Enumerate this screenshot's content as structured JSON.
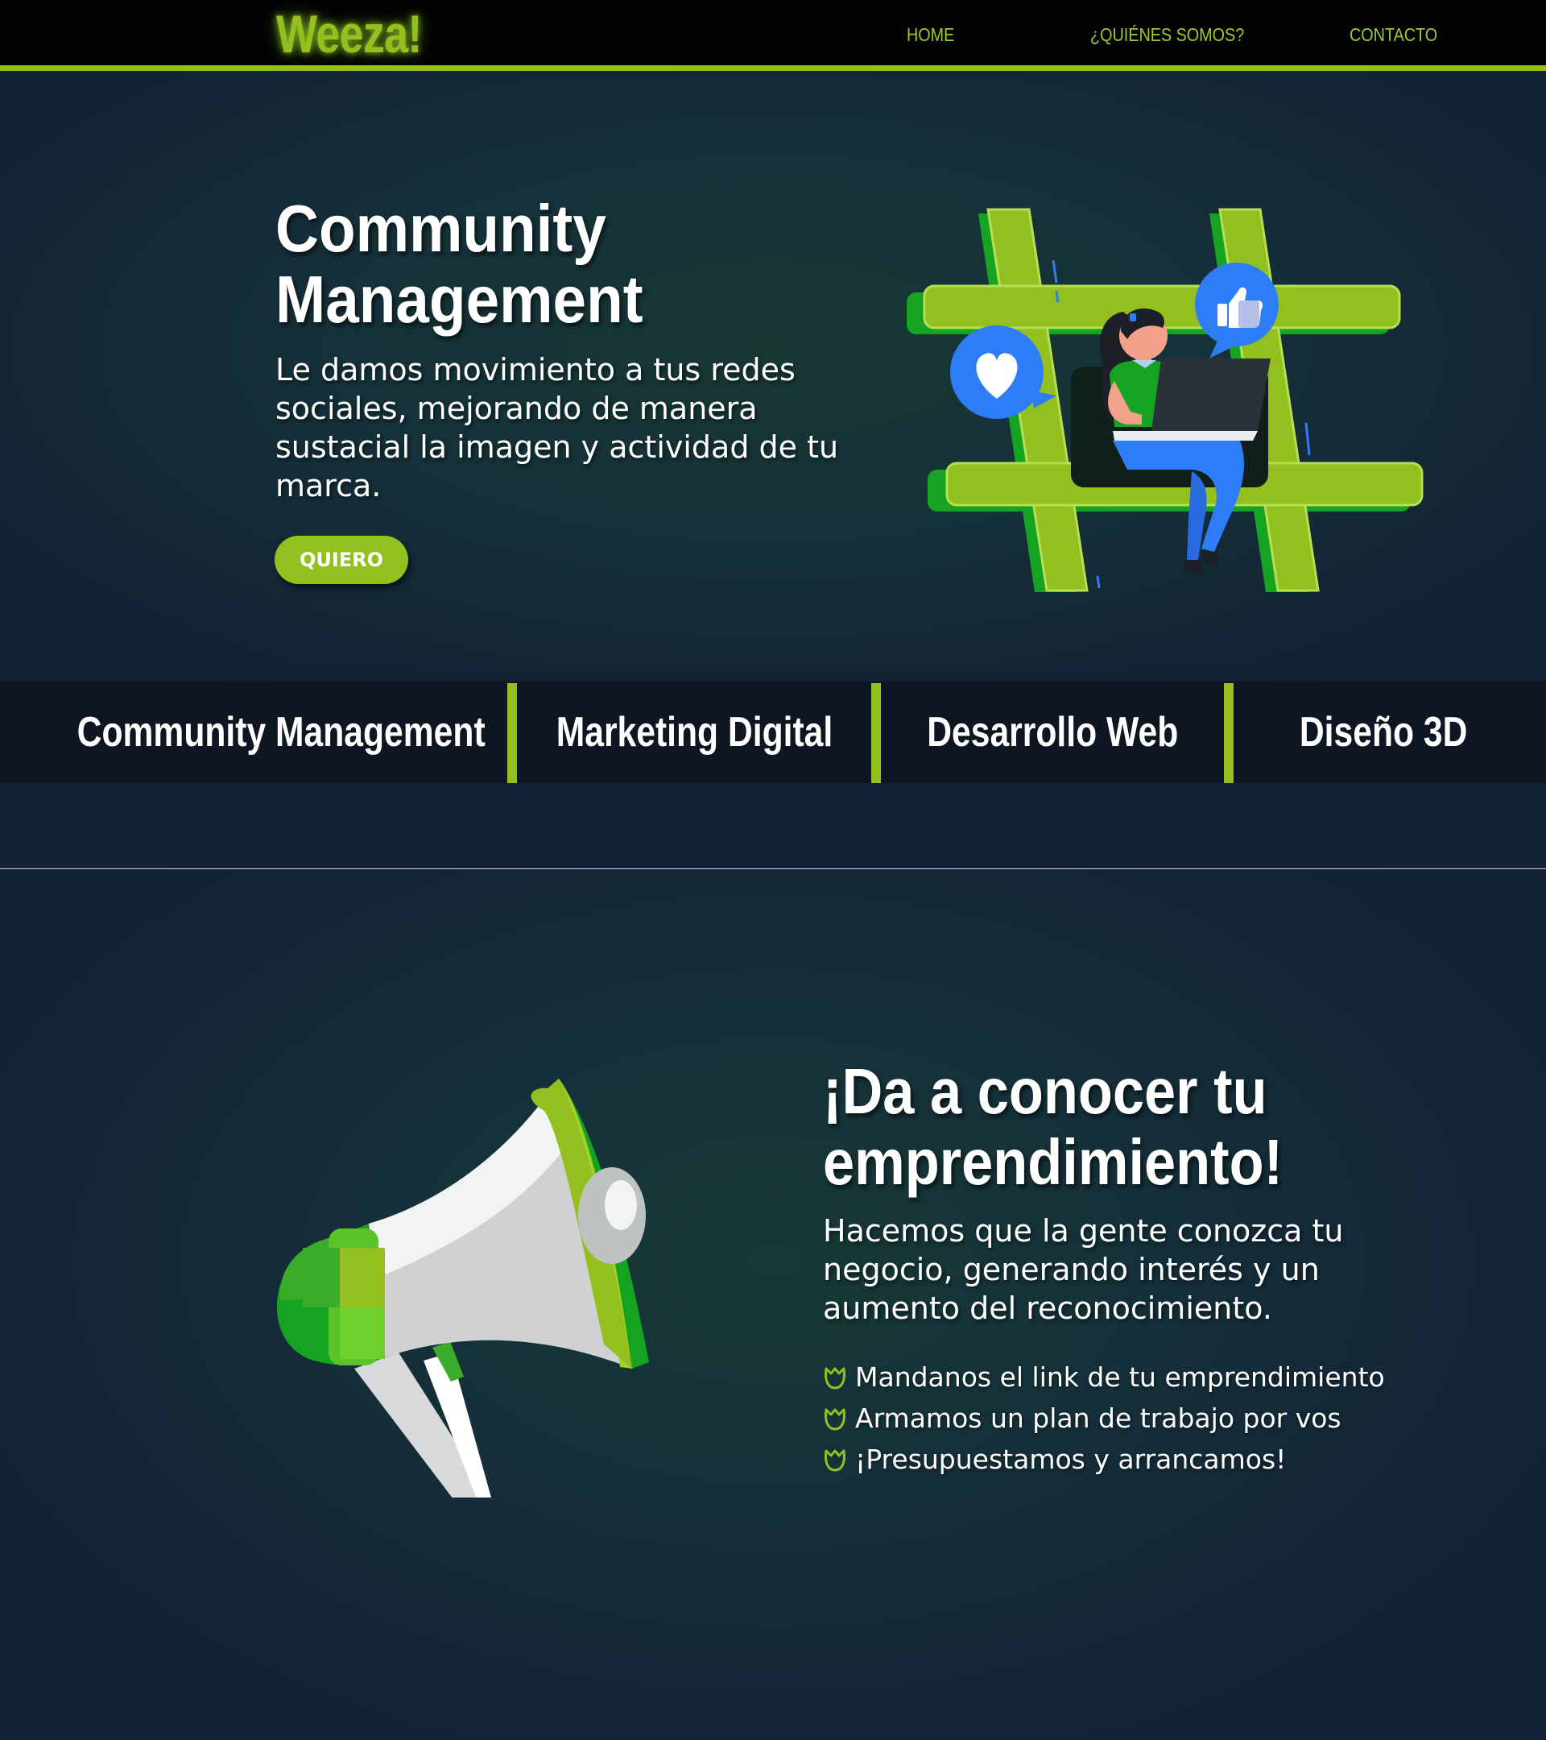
{
  "nav": {
    "brand": "Weeza!",
    "links": [
      "HOME",
      "¿QUIÉNES SOMOS?",
      "CONTACTO"
    ]
  },
  "hero": {
    "title_line1": "Community",
    "title_line2": "Management",
    "text": "Le damos movimiento a tus redes sociales, mejorando de manera sustacial la imagen y actividad de tu marca.",
    "cta": "QUIERO",
    "illustration": "hashtag-woman-laptop-illustration"
  },
  "services": [
    "Community Management",
    "Marketing Digital",
    "Desarrollo Web",
    "Diseño 3D"
  ],
  "promo": {
    "title_line1": "¡Da a conocer tu",
    "title_line2": "emprendimiento!",
    "text": "Hacemos que la gente conozca tu negocio, generando interés y un aumento del reconocimiento.",
    "bullets": [
      "Mandanos el link de tu emprendimiento",
      "Armamos un plan de trabajo por vos",
      "¡Presupuestamos y arrancamos!"
    ],
    "bullet_icon": "tulip-icon",
    "illustration": "megaphone-illustration"
  },
  "colors": {
    "accent": "#93c01f",
    "navbar_bg": "#020304",
    "page_bg": "#142235",
    "services_bg": "#0d1621",
    "illustration_blue": "#2f7df6",
    "illustration_green": "#17a322"
  }
}
